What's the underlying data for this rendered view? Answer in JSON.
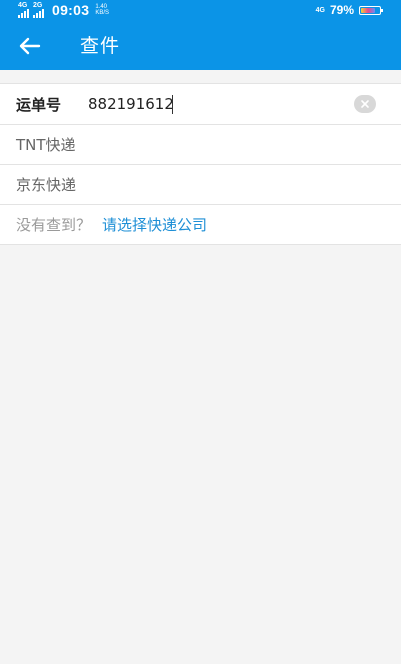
{
  "status_bar": {
    "signal1_tag": "4G",
    "signal2_tag": "2G",
    "time": "09:03",
    "speed_value": "1.40",
    "speed_unit": "KB/S",
    "network_tag": "4G",
    "battery_percent": "79%",
    "battery_level": 0.79
  },
  "app_bar": {
    "back_icon": "arrow-left-icon",
    "title": "查件"
  },
  "query_form": {
    "waybill_label": "运单号",
    "waybill_value": "882191612",
    "clear_icon": "clear-circle-icon"
  },
  "company_list": [
    {
      "name": "TNT快递"
    },
    {
      "name": "京东快递"
    }
  ],
  "not_found": {
    "hint": "没有查到？",
    "link": "请选择快递公司"
  },
  "colors": {
    "primary": "#0b94e7",
    "link": "#1e8fd6",
    "background": "#f4f4f4"
  }
}
